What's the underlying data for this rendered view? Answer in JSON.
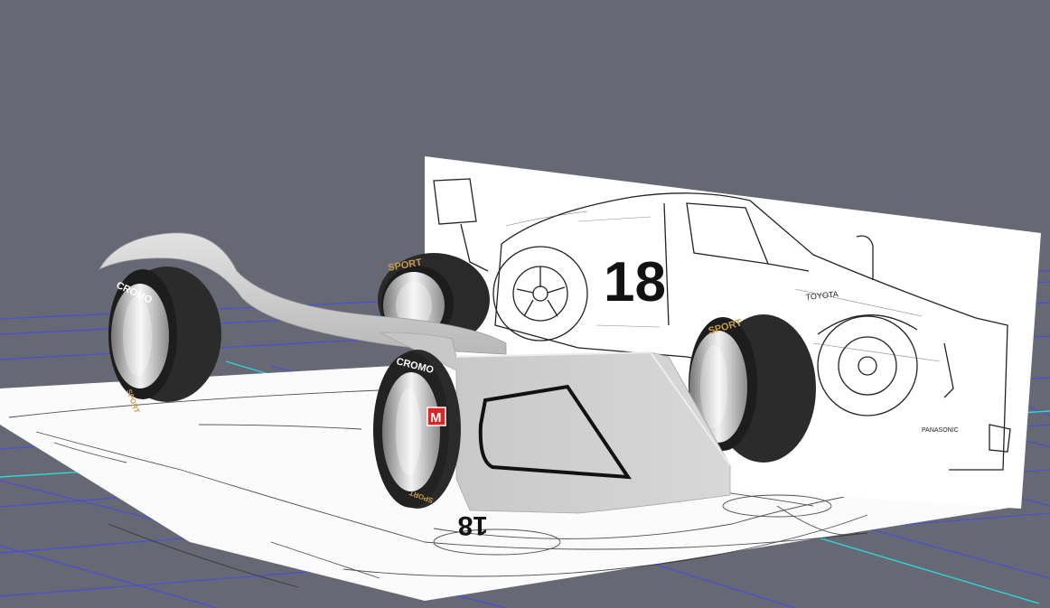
{
  "viewport": {
    "background": "#666974",
    "grid_color": "#4a4fd6",
    "axis_color": "#2fd3d9"
  },
  "blueprint_side": {
    "car_number": "18",
    "small_text_1": "TOYOTA",
    "small_text_2": "PANASONIC"
  },
  "blueprint_top": {
    "car_number": "18"
  },
  "tires": {
    "rear_left_brand": "CROMO",
    "rear_left_sub": "SPORT",
    "rear_right_brand": "SPORT",
    "front_left_brand": "CROMO",
    "front_left_sub": "SPORT",
    "front_right_brand": "SPORT"
  },
  "marker": {
    "label": "M",
    "color": "#e02424"
  }
}
